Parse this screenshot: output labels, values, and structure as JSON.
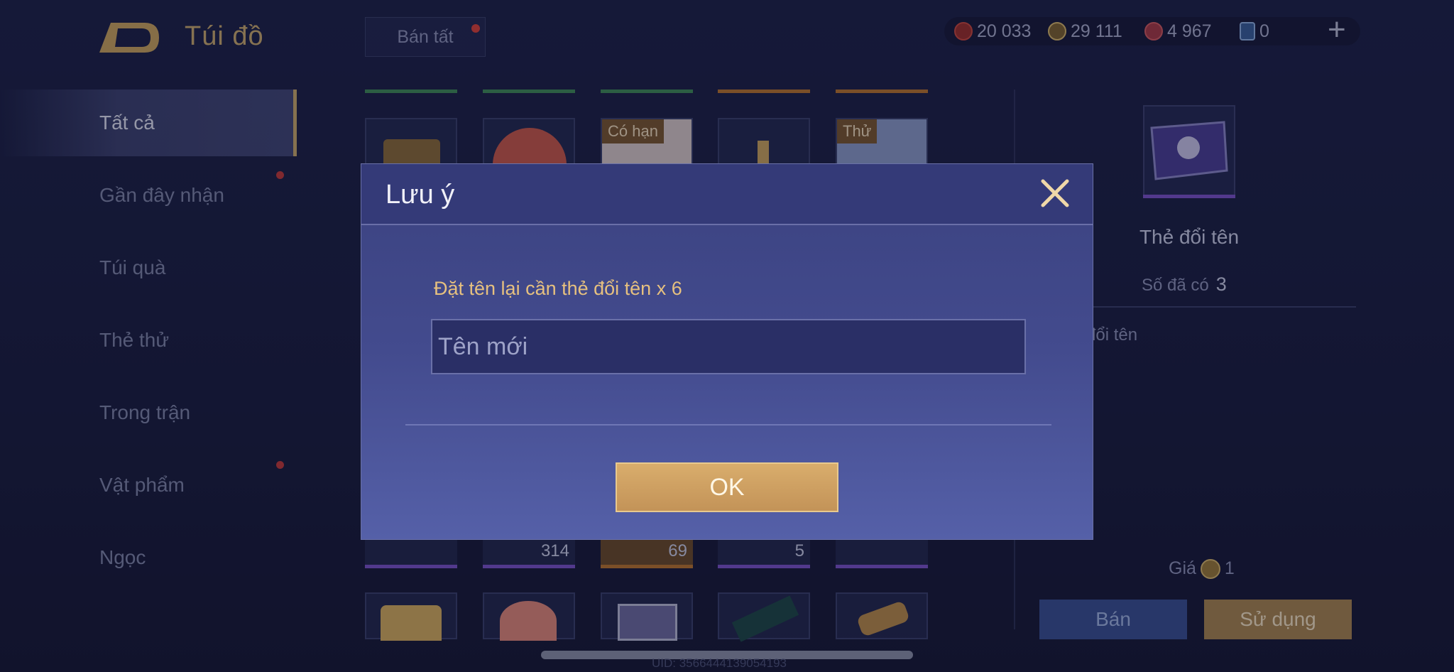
{
  "header": {
    "title": "Túi đồ",
    "sell_all_label": "Bán tất",
    "currencies": [
      {
        "icon": "red-gem-icon",
        "value": "20 033",
        "color": "#b8403a"
      },
      {
        "icon": "gold-coin-icon",
        "value": "29 111",
        "color": "#c9a05a"
      },
      {
        "icon": "ruby-icon",
        "value": "4 967",
        "color": "#c0394a"
      },
      {
        "icon": "blue-card-icon",
        "value": "0",
        "color": "#7fa3d8"
      }
    ],
    "add_label": "+"
  },
  "sidebar": {
    "items": [
      {
        "label": "Tất cả",
        "active": true
      },
      {
        "label": "Gần đây nhận",
        "dot": true
      },
      {
        "label": "Túi quà"
      },
      {
        "label": "Thẻ thử"
      },
      {
        "label": "Trong trận"
      },
      {
        "label": "Vật phẩm",
        "dot": true
      },
      {
        "label": "Ngọc"
      }
    ]
  },
  "grid": {
    "tags": [
      "Có hạn",
      "Thử"
    ],
    "counts": [
      "314",
      "69",
      "5"
    ]
  },
  "detail": {
    "item_name": "Thẻ đổi tên",
    "owned_label": "Số đã có",
    "owned_value": "3",
    "description": "đổi tên",
    "price_label": "Giá",
    "price_value": "1",
    "sell_label": "Bán",
    "use_label": "Sử dụng"
  },
  "footer": {
    "uid": "UID: 3566444139054193"
  },
  "modal": {
    "title": "Lưu ý",
    "hint": "Đặt tên lại cần thẻ đổi tên x 6",
    "input_placeholder": "Tên mới",
    "ok_label": "OK"
  }
}
